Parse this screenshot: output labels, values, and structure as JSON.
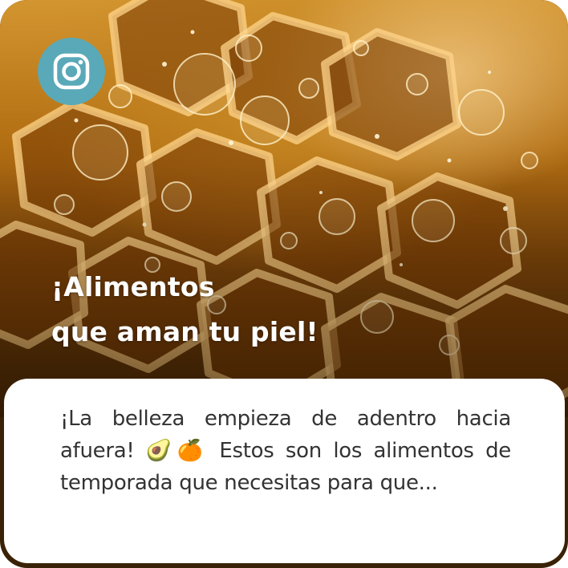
{
  "post": {
    "platform_icon": "instagram-icon",
    "headline_line1": "¡Alimentos",
    "headline_line2": "que aman tu piel!",
    "caption": "¡La belleza empieza de adentro hacia afuera! 🥑🍊 Estos son los alimentos de temporada que necesitas para que..."
  },
  "colors": {
    "badge": "#5aa9b8",
    "honey": "#c98a25",
    "caption_text": "#333333"
  }
}
